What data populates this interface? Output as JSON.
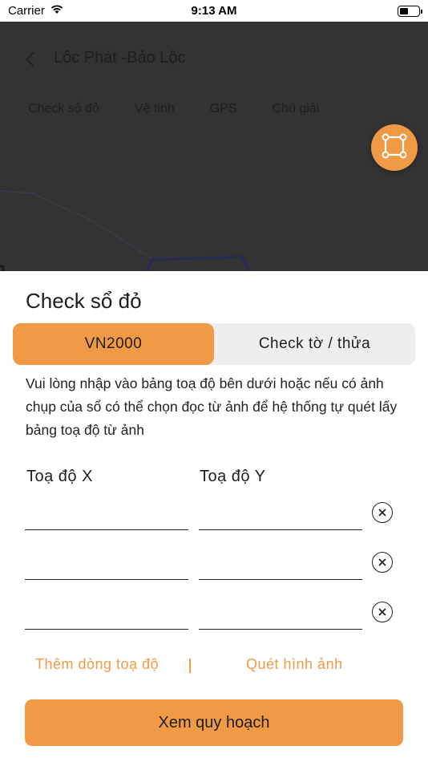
{
  "status": {
    "carrier": "Carrier",
    "time": "9:13 AM",
    "battery_level": 0.5
  },
  "header": {
    "title": "Lộc Phát -Bảo Lộc"
  },
  "map_tabs": [
    "Check sổ đỏ",
    "Vệ tinh",
    "GPS",
    "Chú giải"
  ],
  "colors": {
    "accent": "#f19a45",
    "overlay": "#333333"
  },
  "sheet": {
    "title": "Check sổ đỏ",
    "segments": [
      "VN2000",
      "Check tờ / thửa"
    ],
    "active_segment": "VN2000",
    "description": "Vui lòng nhập vào bảng toạ độ bên dưới hoặc nếu có ảnh chụp của sổ có thể chọn đọc từ ảnh để hệ thống tự quét lấy bảng toạ độ từ ảnh",
    "col_x": "Toạ độ X",
    "col_y": "Toạ độ Y",
    "rows": [
      {
        "x": "",
        "y": ""
      },
      {
        "x": "",
        "y": ""
      },
      {
        "x": "",
        "y": ""
      }
    ],
    "add_row_label": "Thêm dòng toạ độ",
    "scan_label": "Quét hình ảnh",
    "submit_label": "Xem quy hoạch"
  }
}
